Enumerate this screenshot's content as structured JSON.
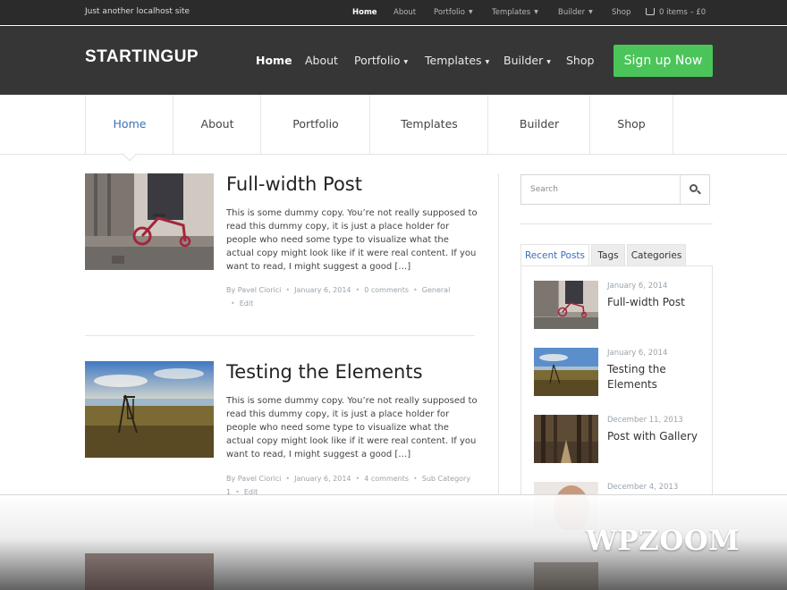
{
  "topbar": {
    "tagline": "Just another localhost site",
    "nav": [
      "Home",
      "About",
      "Portfolio",
      "Templates",
      "Builder",
      "Shop"
    ],
    "cart": "0 items – £0"
  },
  "header": {
    "logo": "STARTINGUP",
    "nav": [
      "Home",
      "About",
      "Portfolio",
      "Templates",
      "Builder",
      "Shop"
    ],
    "signup": "Sign up Now"
  },
  "subnav": [
    "Home",
    "About",
    "Portfolio",
    "Templates",
    "Builder",
    "Shop"
  ],
  "posts": [
    {
      "title": "Full-width Post",
      "excerpt": "This is some dummy copy. You’re not really supposed to read this dummy copy, it is just a place holder for people who need some type to visualize what the actual copy might look like if it were real content. If you want to read, I might suggest a good […]",
      "author": "By Pavel Ciorici",
      "date": "January 6, 2014",
      "comments": "0 comments",
      "category": "General",
      "edit": "Edit"
    },
    {
      "title": "Testing the Elements",
      "excerpt": "This is some dummy copy. You’re not really supposed to read this dummy copy, it is just a place holder for people who need some type to visualize what the actual copy might look like if it were real content. If you want to read, I might suggest a good […]",
      "author": "By Pavel Ciorici",
      "date": "January 6, 2014",
      "comments": "4 comments",
      "category": "Sub Category 1",
      "edit": "Edit"
    }
  ],
  "sidebar": {
    "search_placeholder": "Search",
    "tabs": [
      "Recent Posts",
      "Tags",
      "Categories"
    ],
    "recent": [
      {
        "date": "January 6, 2014",
        "title": "Full-width Post"
      },
      {
        "date": "January 6, 2014",
        "title": "Testing the Elements"
      },
      {
        "date": "December 11, 2013",
        "title": "Post with Gallery"
      },
      {
        "date": "December 4, 2013",
        "title": ""
      }
    ]
  },
  "watermark": "WPZOOM",
  "colors": {
    "accent": "#3b6fb6",
    "signup": "#4bc559",
    "header": "#363636"
  }
}
